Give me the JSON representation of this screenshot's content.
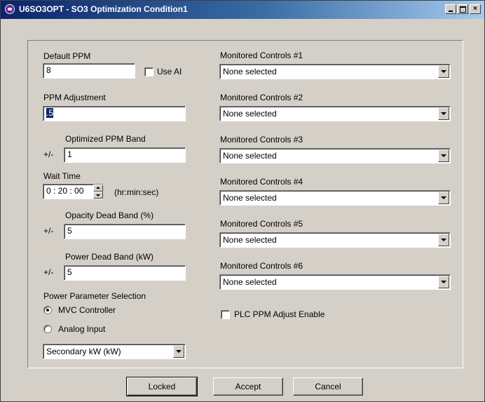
{
  "window": {
    "title": "U6SO3OPT - SO3 Optimization Condition1",
    "minimize": "_",
    "maximize": "□",
    "close": "×"
  },
  "left": {
    "default_ppm_label": "Default PPM",
    "default_ppm_value": "8",
    "use_ai_label": "Use AI",
    "ppm_adjustment_label": "PPM Adjustment",
    "ppm_adjustment_value": ".5",
    "optimized_band_label": "Optimized PPM Band",
    "plus_minus_1": "+/-",
    "optimized_band_value": "1",
    "wait_time_label": "Wait Time",
    "wait_time_value": "0 : 20 : 00",
    "wait_time_units": "(hr:min:sec)",
    "opacity_label": "Opacity Dead Band (%)",
    "plus_minus_2": "+/-",
    "opacity_value": "5",
    "power_dead_label": "Power Dead Band (kW)",
    "plus_minus_3": "+/-",
    "power_dead_value": "5",
    "power_param_label": "Power Parameter Selection",
    "radio_mvc_label": "MVC Controller",
    "radio_analog_label": "Analog Input",
    "power_select_value": "Secondary kW (kW)"
  },
  "right": {
    "controls": [
      {
        "label": "Monitored Controls #1",
        "value": "None selected"
      },
      {
        "label": "Monitored Controls #2",
        "value": "None selected"
      },
      {
        "label": "Monitored Controls #3",
        "value": "None selected"
      },
      {
        "label": "Monitored Controls #4",
        "value": "None selected"
      },
      {
        "label": "Monitored Controls #5",
        "value": "None selected"
      },
      {
        "label": "Monitored Controls #6",
        "value": "None selected"
      }
    ],
    "plc_label": "PLC PPM Adjust Enable"
  },
  "buttons": {
    "locked": "Locked",
    "accept": "Accept",
    "cancel": "Cancel"
  }
}
